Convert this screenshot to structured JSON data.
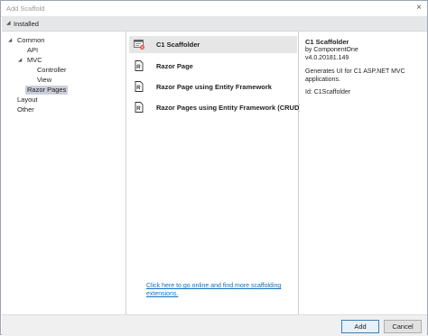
{
  "window": {
    "title": "Add Scaffold",
    "close_glyph": "×"
  },
  "category_bar": {
    "label": "Installed"
  },
  "tree": {
    "common": "Common",
    "api": "API",
    "mvc": "MVC",
    "controller": "Controller",
    "view": "View",
    "razor_pages": "Razor Pages",
    "layout": "Layout",
    "other": "Other",
    "selected": "Razor Pages"
  },
  "scaffolders": [
    {
      "label": "C1 Scaffolder",
      "icon": "c1-scaffolder-icon"
    },
    {
      "label": "Razor Page",
      "icon": "page-icon"
    },
    {
      "label": "Razor Page using Entity Framework",
      "icon": "page-ef-icon"
    },
    {
      "label": "Razor Pages using Entity Framework (CRUD)",
      "icon": "page-crud-icon"
    }
  ],
  "selected_scaffolder": "C1 Scaffolder",
  "details": {
    "title": "C1 Scaffolder",
    "by": "by ComponentOne",
    "version": "v4.0.20181.149",
    "description": "Generates UI for C1 ASP.NET MVC applications.",
    "id": "Id: C1Scaffolder"
  },
  "online_link": "Click here to go online and find more scaffolding extensions.",
  "buttons": {
    "add": "Add",
    "cancel": "Cancel"
  },
  "colors": {
    "accent": "#0e70c0",
    "selection": "#cccedb",
    "badge_red": "#e53935"
  }
}
